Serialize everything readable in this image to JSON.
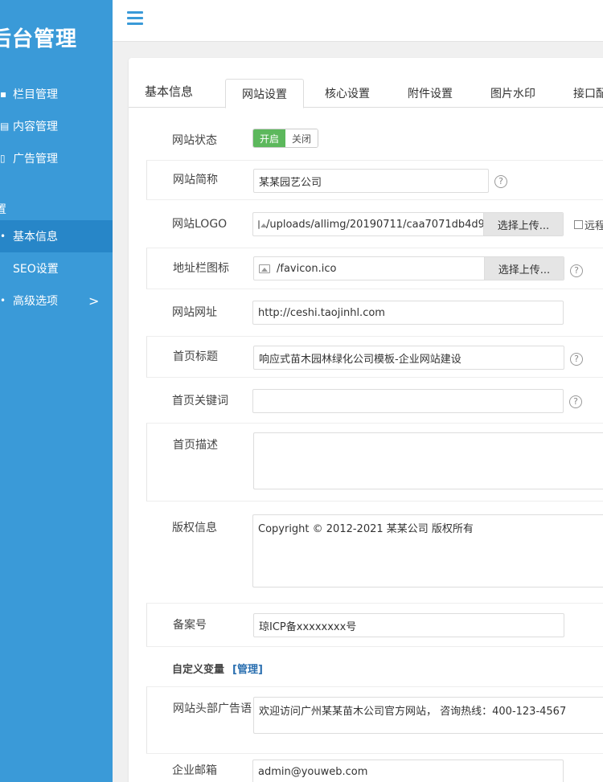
{
  "sidebar": {
    "brand": "后台管理",
    "items": [
      {
        "label": "栏目管理",
        "icon": "list-icon"
      },
      {
        "label": "内容管理",
        "icon": "document-icon"
      },
      {
        "label": "广告管理",
        "icon": "ad-icon"
      }
    ],
    "section_label": "置",
    "sub_items": [
      {
        "label": "基本信息",
        "icon": "dot-icon"
      },
      {
        "label": "SEO设置",
        "icon": ""
      },
      {
        "label": "高级选项",
        "icon": "dot-icon",
        "chevron": ">"
      }
    ]
  },
  "panel": {
    "section_title": "基本信息",
    "tabs": [
      "网站设置",
      "核心设置",
      "附件设置",
      "图片水印",
      "接口配"
    ]
  },
  "form": {
    "status": {
      "label": "网站状态",
      "on": "开启",
      "off": "关闭"
    },
    "short_name": {
      "label": "网站简称",
      "value": "某某园艺公司"
    },
    "logo": {
      "label": "网站LOGO",
      "value": "/uploads/allimg/20190711/caa7071db4d9",
      "button": "选择上传...",
      "remote": "远程"
    },
    "favicon": {
      "label": "地址栏图标",
      "value": "/favicon.ico",
      "button": "选择上传..."
    },
    "url": {
      "label": "网站网址",
      "value": "http://ceshi.taojinhl.com"
    },
    "home_title": {
      "label": "首页标题",
      "value": "响应式苗木园林绿化公司模板-企业网站建设"
    },
    "keywords": {
      "label": "首页关键词",
      "value": ""
    },
    "description": {
      "label": "首页描述",
      "value": ""
    },
    "copyright": {
      "label": "版权信息",
      "value": "Copyright © 2012-2021 某某公司 版权所有"
    },
    "icp": {
      "label": "备案号",
      "value": "琼ICP备xxxxxxxx号"
    },
    "custom": {
      "title": "自定义变量",
      "manage": "[管理]"
    },
    "header_ad": {
      "label": "网站头部广告语",
      "value": "欢迎访问广州某某苗木公司官方网站， 咨询热线：400-123-4567"
    },
    "email": {
      "label": "企业邮箱",
      "value": "admin@youweb.com"
    }
  },
  "help_glyph": "?"
}
